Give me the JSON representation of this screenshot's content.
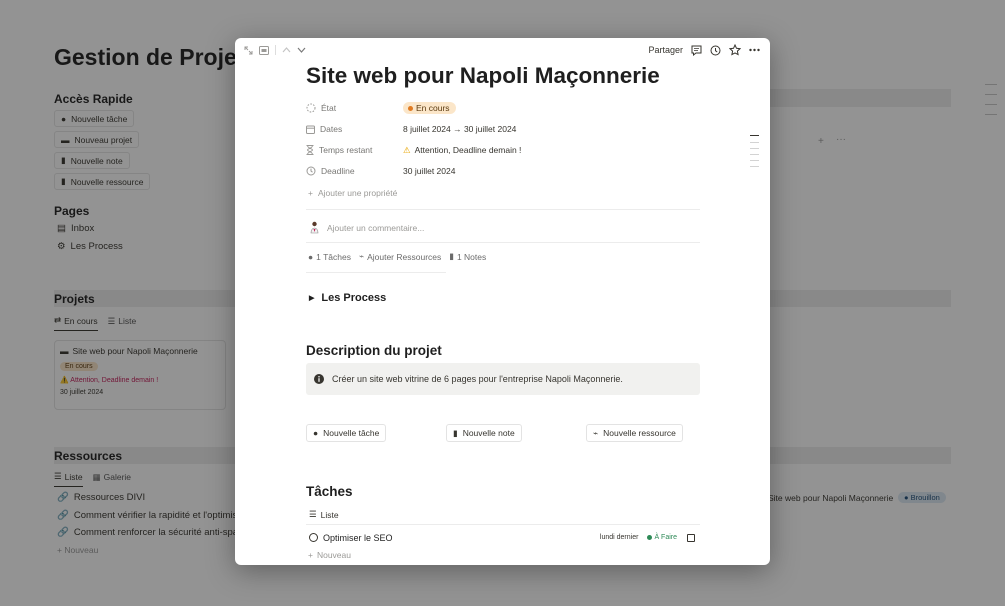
{
  "background": {
    "page_title": "Gestion de Projet",
    "quick_access": {
      "title": "Accès Rapide",
      "buttons": [
        "Nouvelle tâche",
        "Nouveau projet",
        "Nouvelle note",
        "Nouvelle ressource"
      ]
    },
    "pages": {
      "title": "Pages",
      "items": [
        "Inbox",
        "Les Process"
      ]
    },
    "projects": {
      "title": "Projets",
      "tabs": [
        "En cours",
        "Liste"
      ],
      "card": {
        "title": "Site web pour Napoli Maçonnerie",
        "status": "En cours",
        "warning": "⚠️ Attention, Deadline demain !",
        "date": "30 juillet 2024"
      }
    },
    "resources": {
      "title": "Ressources",
      "tabs": [
        "Liste",
        "Galerie"
      ],
      "items": [
        "Ressources DIVI",
        "Comment vérifier la rapidité et l'optimisa",
        "Comment renforcer la sécurité anti-spa"
      ],
      "add_label": "+ Nouveau",
      "related_project": "Site web pour Napoli Maçonnerie",
      "related_status": "Brouillon"
    }
  },
  "modal": {
    "toolbar": {
      "share_label": "Partager"
    },
    "title": "Site web pour Napoli Maçonnerie",
    "properties": [
      {
        "label": "État",
        "value": "En cours",
        "icon": "status-icon"
      },
      {
        "label": "Dates",
        "value": "8 juillet 2024 → 30 juillet 2024",
        "icon": "calendar-icon"
      },
      {
        "label": "Temps restant",
        "value": "Attention, Deadline demain !",
        "icon": "hourglass-icon"
      },
      {
        "label": "Deadline",
        "value": "30 juillet 2024",
        "icon": "clock-icon"
      }
    ],
    "add_property": "Ajouter une propriété",
    "comment_placeholder": "Ajouter un commentaire...",
    "relations": {
      "tasks": "1 Tâches",
      "resources": "Ajouter Ressources",
      "notes": "1 Notes"
    },
    "process_toggle": "Les Process",
    "description": {
      "heading": "Description du projet",
      "callout": "Créer un site web vitrine de 6 pages pour l'entreprise Napoli Maçonnerie."
    },
    "action_buttons": [
      "Nouvelle tâche",
      "Nouvelle note",
      "Nouvelle ressource"
    ],
    "tasks": {
      "heading": "Tâches",
      "view_label": "Liste",
      "rows": [
        {
          "name": "Optimiser le SEO",
          "date": "lundi dernier",
          "status": "À Faire"
        }
      ],
      "new_label": "Nouveau"
    }
  },
  "colors": {
    "status_bg": "#fbe6c9",
    "warning": "#c4205b",
    "todo": "#2e8a57",
    "overlay": "rgba(15,15,15,0.45)"
  }
}
